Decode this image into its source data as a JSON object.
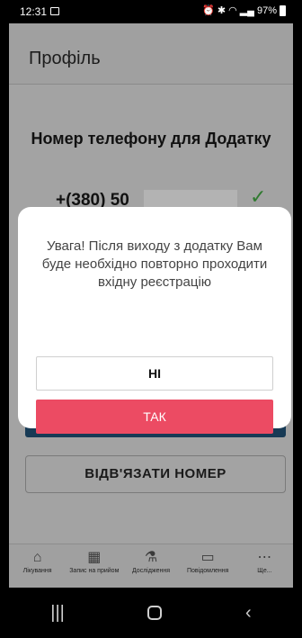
{
  "status_bar": {
    "time": "12:31",
    "battery": "97%",
    "icons": [
      "image-icon",
      "alarm-icon",
      "bluetooth-icon",
      "wifi-icon",
      "signal-icon",
      "battery-icon"
    ]
  },
  "header": {
    "title": "Профіль"
  },
  "profile": {
    "section_title": "Номер телефону для Додатку",
    "phone_prefix": "+(380) 50",
    "verified_icon": "check-icon",
    "unbind_label": "ВІДВ'ЯЗАТИ НОМЕР"
  },
  "dialog": {
    "message": "Увага! Після виходу з додатку Вам буде необхідно повторно проходити вхідну реєстрацію",
    "no_label": "НІ",
    "yes_label": "ТАК",
    "yes_color": "#ec4b63"
  },
  "bottom_nav": {
    "items": [
      {
        "label": "Лікування",
        "icon": "home-icon"
      },
      {
        "label": "Запис на прийом",
        "icon": "calendar-icon"
      },
      {
        "label": "Дослідження",
        "icon": "flask-icon"
      },
      {
        "label": "Повідомлення",
        "icon": "message-icon"
      },
      {
        "label": "Ще...",
        "icon": "more-icon"
      }
    ]
  },
  "system_nav": {
    "icons": [
      "recents-icon",
      "home-icon",
      "back-icon"
    ]
  }
}
